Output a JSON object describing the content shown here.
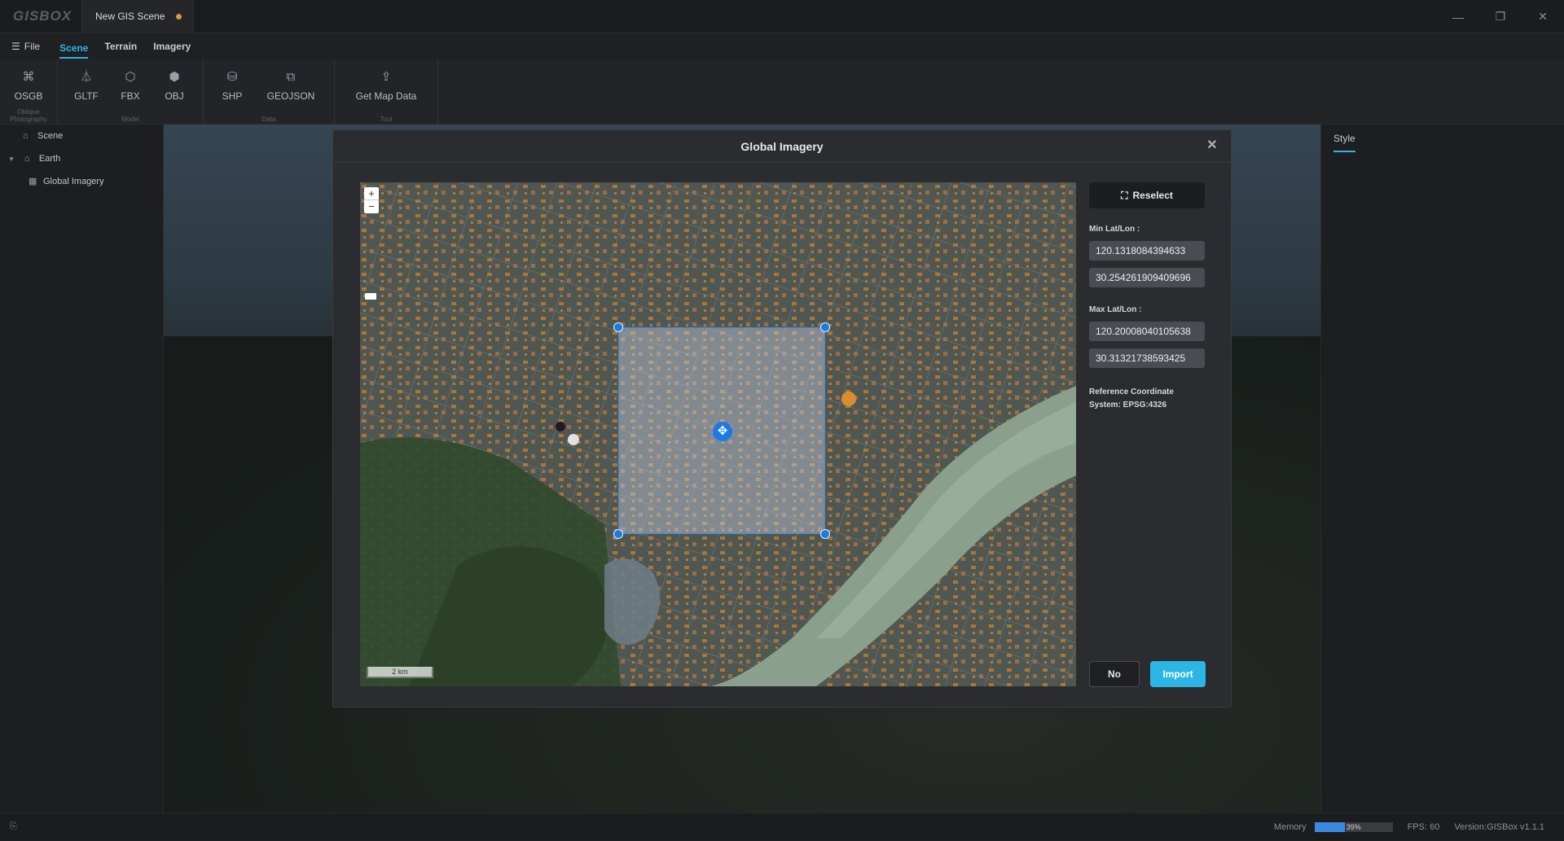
{
  "app": {
    "logo": "GISBOX",
    "document_tab": "New GIS Scene"
  },
  "window_controls": {
    "minimize_icon": "minimize-icon",
    "restore_icon": "restore-icon",
    "close_icon": "close-icon"
  },
  "menubar": {
    "file_label": "File",
    "tabs": [
      {
        "label": "Scene",
        "active": true
      },
      {
        "label": "Terrain"
      },
      {
        "label": "Imagery"
      }
    ]
  },
  "ribbon": {
    "groups": [
      {
        "caption": "Oblique Photography",
        "buttons": [
          {
            "label": "OSGB",
            "icon": "osgb-icon"
          }
        ]
      },
      {
        "caption": "Model",
        "buttons": [
          {
            "label": "GLTF",
            "icon": "gltf-icon"
          },
          {
            "label": "FBX",
            "icon": "fbx-icon"
          },
          {
            "label": "OBJ",
            "icon": "obj-icon"
          }
        ]
      },
      {
        "caption": "Data",
        "buttons": [
          {
            "label": "SHP",
            "icon": "shp-icon"
          },
          {
            "label": "GEOJSON",
            "icon": "geojson-icon"
          }
        ]
      },
      {
        "caption": "Tool",
        "buttons": [
          {
            "label": "Get Map Data",
            "icon": "get-map-data-icon"
          }
        ]
      }
    ]
  },
  "tree": [
    {
      "label": "Scene",
      "icon": "scene-icon"
    },
    {
      "label": "Earth",
      "icon": "earth-icon"
    },
    {
      "label": "Global Imagery",
      "icon": "imagery-icon"
    }
  ],
  "right_panel": {
    "tab": "Style"
  },
  "dialog": {
    "title": "Global Imagery",
    "reselect_label": "Reselect",
    "min_label": "Min Lat/Lon :",
    "min_lon": "120.1318084394633",
    "min_lat": "30.254261909409696",
    "max_label": "Max Lat/Lon :",
    "max_lon": "120.20008040105638",
    "max_lat": "30.31321738593425",
    "reference": "Reference Coordinate System: EPSG:4326",
    "no_label": "No",
    "import_label": "Import",
    "map": {
      "zoom_in": "+",
      "zoom_out": "−",
      "scale": "2 km"
    }
  },
  "statusbar": {
    "memory_label": "Memory",
    "memory_percent": "39%",
    "memory_fraction": 0.39,
    "fps": "FPS: 60",
    "version": "Version:GISBox v1.1.1"
  },
  "colors": {
    "accent": "#2bb6e6",
    "selection": "#1a7be6",
    "tab_dot": "#d99a3d"
  }
}
